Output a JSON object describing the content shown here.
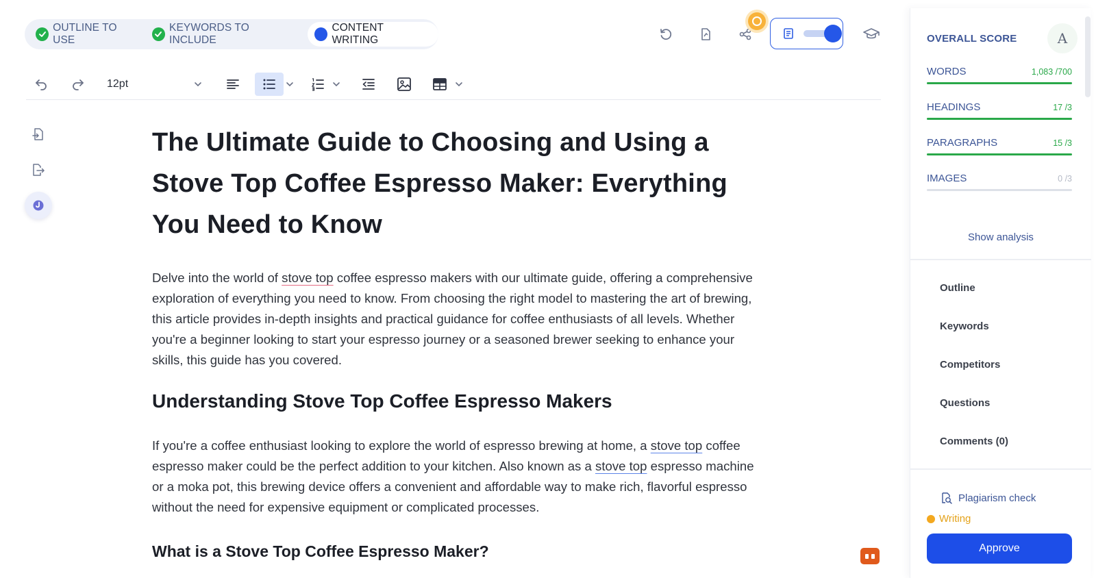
{
  "steps": [
    {
      "label": "OUTLINE TO USE",
      "state": "done"
    },
    {
      "label": "KEYWORDS TO INCLUDE",
      "state": "done"
    },
    {
      "label": "CONTENT WRITING",
      "state": "active"
    }
  ],
  "toolbar": {
    "font_size": "12pt"
  },
  "document": {
    "title": "The Ultimate Guide to Choosing and Using a Stove Top Coffee Espresso Maker: Everything You Need to Know",
    "intro": {
      "before": "Delve into the world of ",
      "highlight": "stove top",
      "after": " coffee espresso makers with our ultimate guide, offering a comprehensive exploration of everything you need to know. From choosing the right model to mastering the art of brewing, this article provides in-depth insights and practical guidance for coffee enthusiasts of all levels. Whether you're a beginner looking to start your espresso journey or a seasoned brewer seeking to enhance your skills, this guide has you covered."
    },
    "section1_heading": "Understanding Stove Top Coffee Espresso Makers",
    "section1_para": {
      "part1": "If you're a coffee enthusiast looking to explore the world of espresso brewing at home, a ",
      "kw1": "stove top",
      "part2": " coffee espresso maker could be the perfect addition to your kitchen. Also known as a ",
      "kw2": "stove top",
      "part3": " espresso machine or a moka pot, this brewing device offers a convenient and affordable way to make rich, flavorful espresso without the need for expensive equipment or complicated processes."
    },
    "section2_heading": "What is a Stove Top Coffee Espresso Maker?"
  },
  "panel": {
    "overall_score_label": "OVERALL SCORE",
    "score_grade": "A",
    "metrics": [
      {
        "name": "WORDS",
        "value": "1,083 /700",
        "fill": 1.0
      },
      {
        "name": "HEADINGS",
        "value": "17 /3",
        "fill": 1.0
      },
      {
        "name": "PARAGRAPHS",
        "value": "15 /3",
        "fill": 1.0
      },
      {
        "name": "IMAGES",
        "value": "0 /3",
        "fill": 0.0
      }
    ],
    "show_analysis": "Show analysis",
    "nav": [
      "Outline",
      "Keywords",
      "Competitors",
      "Questions",
      "Comments (0)"
    ],
    "plagiarism": "Plagiarism check",
    "status": "Writing",
    "approve": "Approve"
  },
  "colors": {
    "accent": "#1d4ee8",
    "success": "#2aa849",
    "warning": "#f3a81f",
    "label_blue": "#3c5596"
  }
}
